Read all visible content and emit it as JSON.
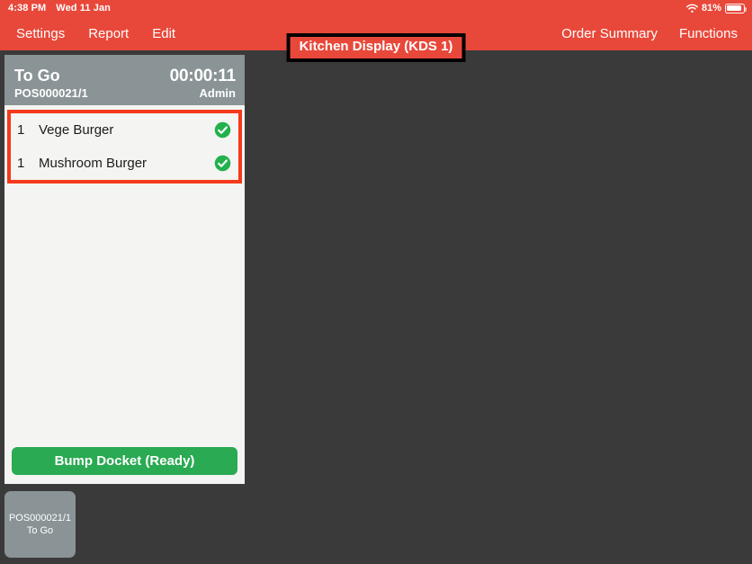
{
  "colors": {
    "header_red": "#e8483a",
    "background_dark": "#3a3a3a",
    "docket_header_grey": "#8a9496",
    "docket_body": "#f4f4f2",
    "highlight_red": "#f5391b",
    "bump_green": "#2aaa52",
    "check_green": "#22b14c"
  },
  "statusbar": {
    "time": "4:38 PM",
    "date": "Wed 11 Jan",
    "wifi_icon": "wifi-icon",
    "battery_percent": "81%",
    "battery_level": 81,
    "battery_icon": "battery-icon"
  },
  "navbar": {
    "left_items": [
      {
        "label": "Settings",
        "name": "nav-item-settings"
      },
      {
        "label": "Report",
        "name": "nav-item-report"
      },
      {
        "label": "Edit",
        "name": "nav-item-edit"
      }
    ],
    "right_items": [
      {
        "label": "Order Summary",
        "name": "nav-item-order-summary"
      },
      {
        "label": "Functions",
        "name": "nav-item-functions"
      }
    ],
    "title": "Kitchen Display (KDS 1)"
  },
  "docket": {
    "order_type": "To Go",
    "reference": "POS000021/1",
    "timer": "00:00:11",
    "user": "Admin",
    "items": [
      {
        "qty": "1",
        "name": "Vege Burger",
        "status_icon": "check-circle-icon"
      },
      {
        "qty": "1",
        "name": "Mushroom Burger",
        "status_icon": "check-circle-icon"
      }
    ],
    "bump_label": "Bump Docket (Ready)"
  },
  "tile": {
    "reference": "POS000021/1",
    "order_type": "To Go"
  }
}
